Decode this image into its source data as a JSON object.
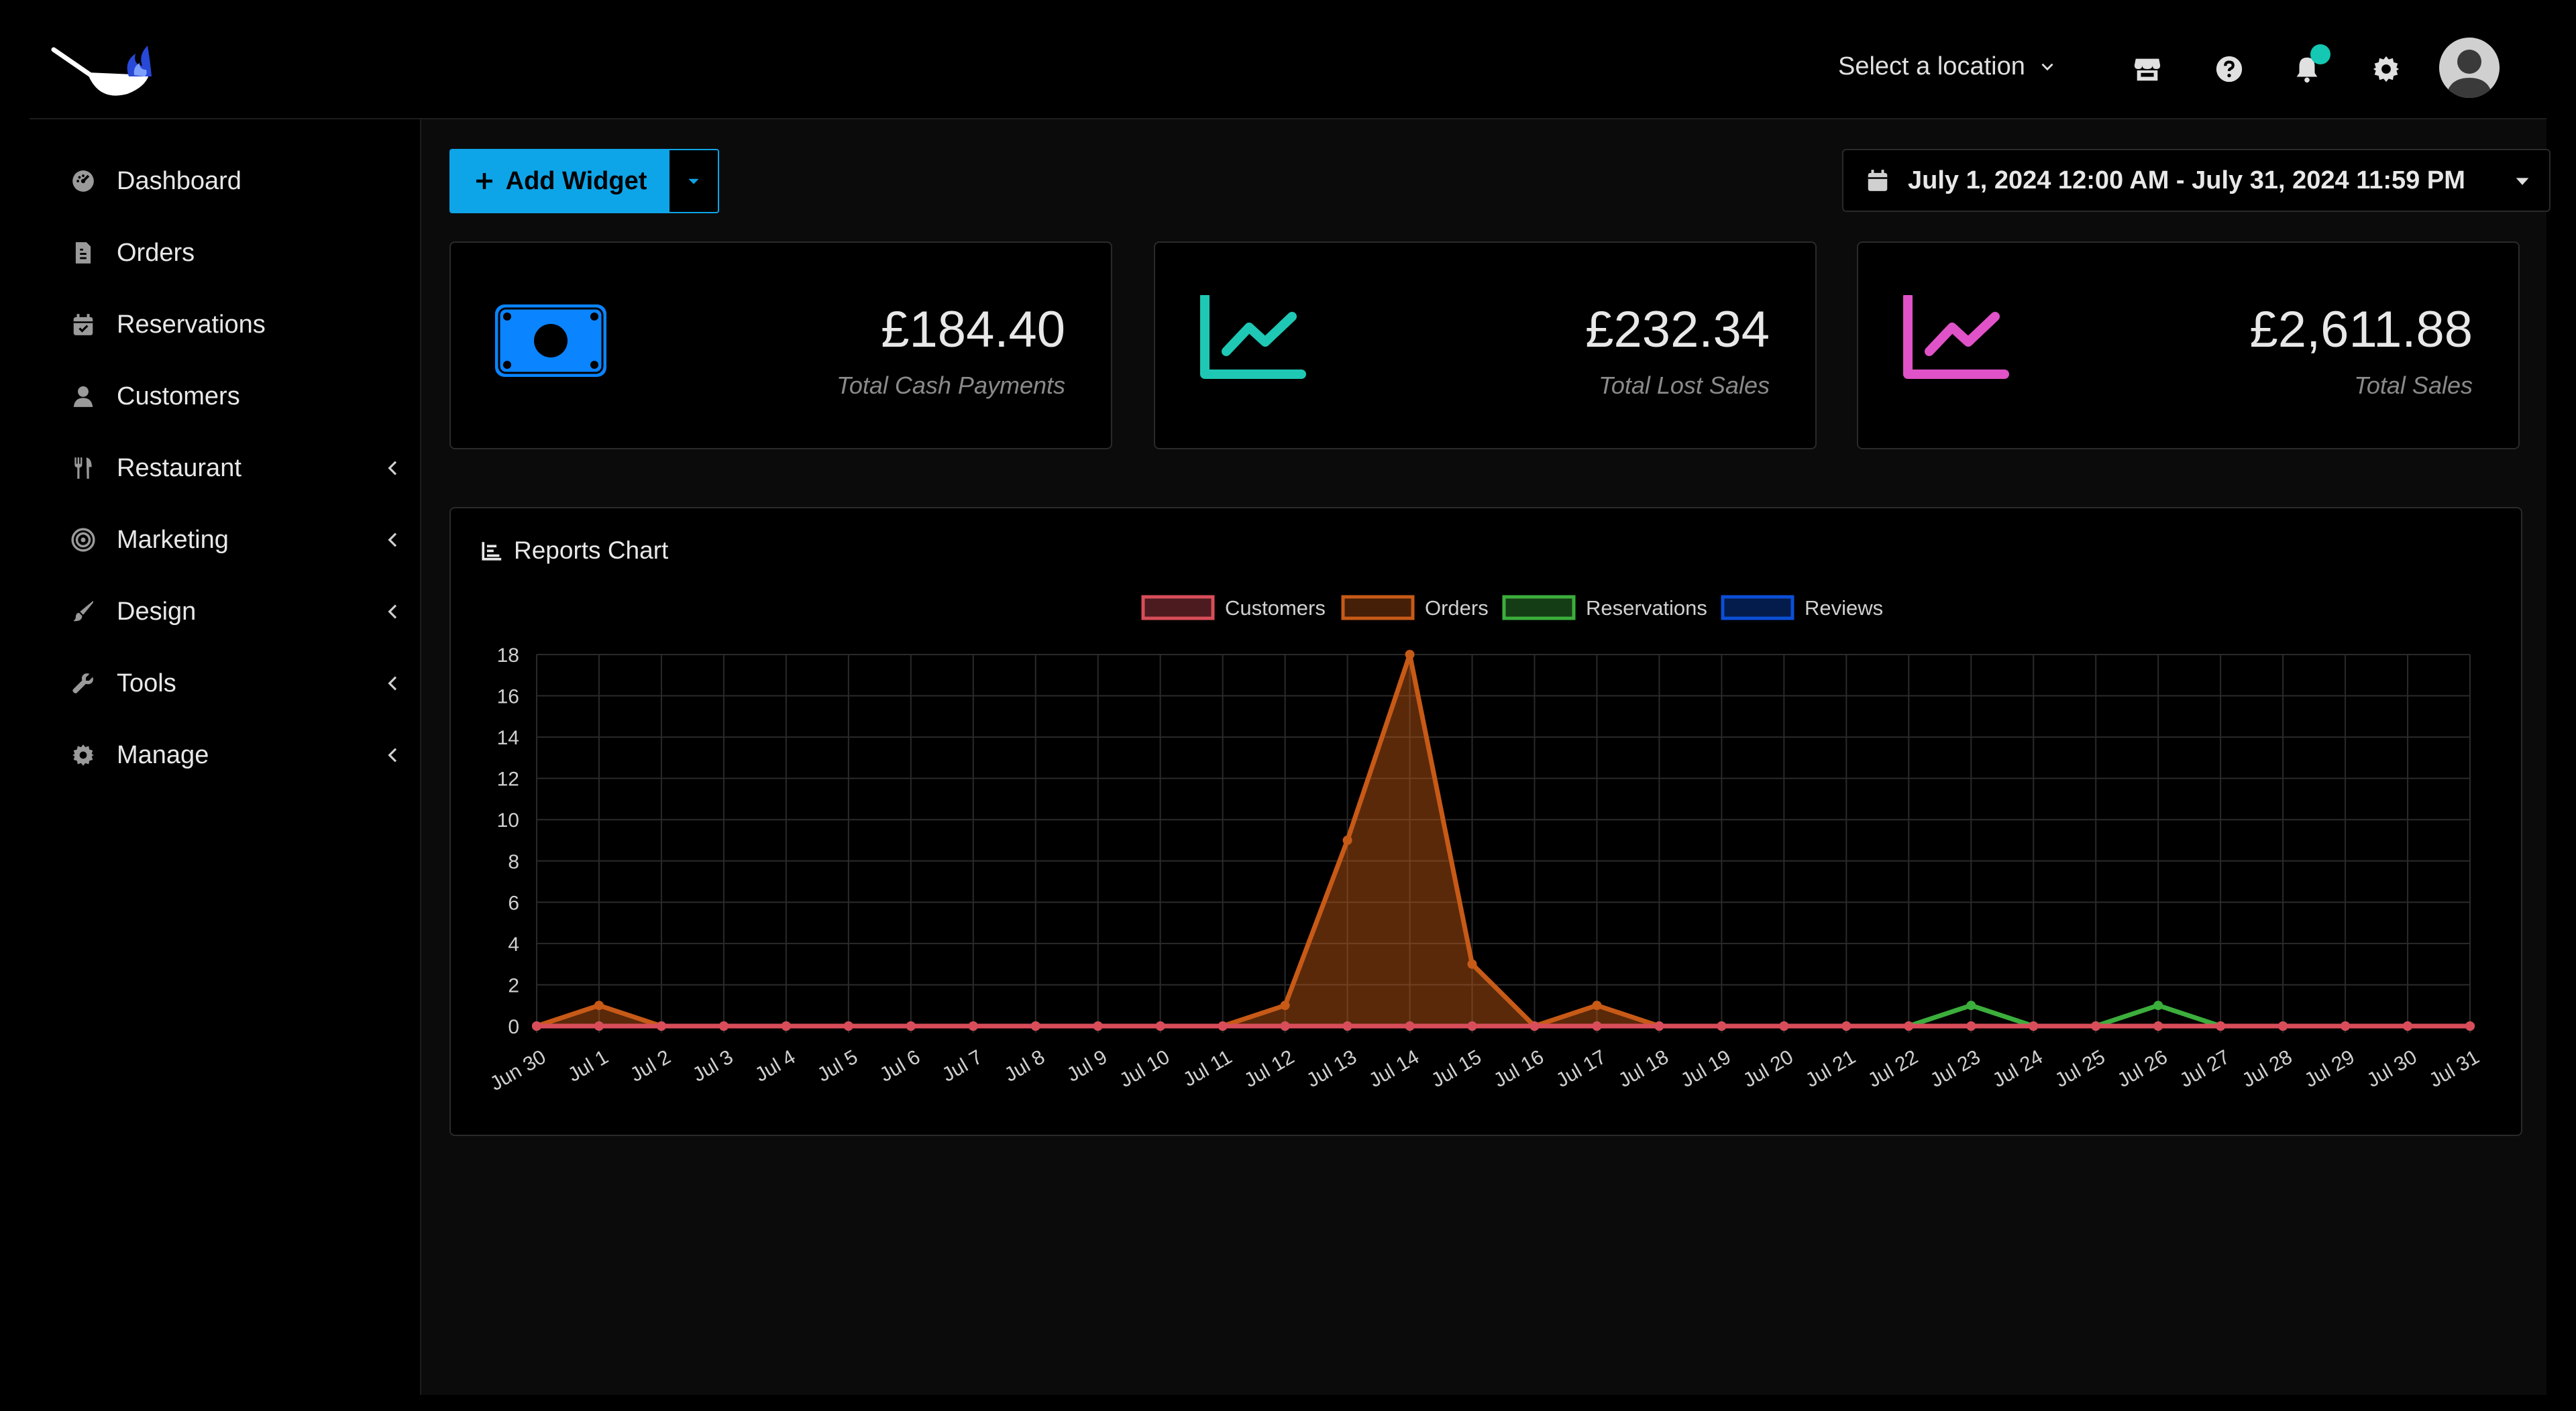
{
  "header": {
    "location_label": "Select a location",
    "icons": [
      "store-icon",
      "help-icon",
      "bell-icon",
      "gear-icon",
      "avatar"
    ]
  },
  "sidebar": {
    "items": [
      {
        "label": "Dashboard",
        "icon": "dashboard-icon",
        "has_submenu": false
      },
      {
        "label": "Orders",
        "icon": "orders-icon",
        "has_submenu": false
      },
      {
        "label": "Reservations",
        "icon": "calendar-icon",
        "has_submenu": false
      },
      {
        "label": "Customers",
        "icon": "user-icon",
        "has_submenu": false
      },
      {
        "label": "Restaurant",
        "icon": "utensils-icon",
        "has_submenu": true
      },
      {
        "label": "Marketing",
        "icon": "target-icon",
        "has_submenu": true
      },
      {
        "label": "Design",
        "icon": "brush-icon",
        "has_submenu": true
      },
      {
        "label": "Tools",
        "icon": "wrench-icon",
        "has_submenu": true
      },
      {
        "label": "Manage",
        "icon": "cog-icon",
        "has_submenu": true
      }
    ]
  },
  "toolbar": {
    "add_widget_label": "Add Widget",
    "date_range": "July 1, 2024 12:00 AM - July 31, 2024 11:59 PM"
  },
  "stats": [
    {
      "value": "£184.40",
      "label": "Total Cash Payments",
      "icon": "money-icon",
      "color": "#0a84ff"
    },
    {
      "value": "£232.34",
      "label": "Total Lost Sales",
      "icon": "line-chart-icon",
      "color": "#1ec8b4"
    },
    {
      "value": "£2,611.88",
      "label": "Total Sales",
      "icon": "line-chart-icon",
      "color": "#e052c8"
    }
  ],
  "chart_title": "Reports Chart",
  "chart_data": {
    "type": "line",
    "categories": [
      "Jun 30",
      "Jul 1",
      "Jul 2",
      "Jul 3",
      "Jul 4",
      "Jul 5",
      "Jul 6",
      "Jul 7",
      "Jul 8",
      "Jul 9",
      "Jul 10",
      "Jul 11",
      "Jul 12",
      "Jul 13",
      "Jul 14",
      "Jul 15",
      "Jul 16",
      "Jul 17",
      "Jul 18",
      "Jul 19",
      "Jul 20",
      "Jul 21",
      "Jul 22",
      "Jul 23",
      "Jul 24",
      "Jul 25",
      "Jul 26",
      "Jul 27",
      "Jul 28",
      "Jul 29",
      "Jul 30",
      "Jul 31"
    ],
    "ylim": [
      0,
      18
    ],
    "yticks": [
      0,
      2,
      4,
      6,
      8,
      10,
      12,
      14,
      16,
      18
    ],
    "grid": true,
    "legend": "top-center",
    "series": [
      {
        "name": "Customers",
        "color": "#d94d5a",
        "fill": false,
        "values": [
          0,
          0,
          0,
          0,
          0,
          0,
          0,
          0,
          0,
          0,
          0,
          0,
          0,
          0,
          0,
          0,
          0,
          0,
          0,
          0,
          0,
          0,
          0,
          0,
          0,
          0,
          0,
          0,
          0,
          0,
          0,
          0
        ]
      },
      {
        "name": "Orders",
        "color": "#c75a17",
        "fill": true,
        "values": [
          0,
          1,
          0,
          0,
          0,
          0,
          0,
          0,
          0,
          0,
          0,
          0,
          1,
          9,
          18,
          3,
          0,
          1,
          0,
          0,
          0,
          0,
          0,
          0,
          0,
          0,
          0,
          0,
          0,
          0,
          0,
          0
        ]
      },
      {
        "name": "Reservations",
        "color": "#3cae3c",
        "fill": false,
        "values": [
          0,
          0,
          0,
          0,
          0,
          0,
          0,
          0,
          0,
          0,
          0,
          0,
          0,
          0,
          0,
          0,
          0,
          0,
          0,
          0,
          0,
          0,
          0,
          1,
          0,
          0,
          1,
          0,
          0,
          0,
          0,
          0
        ]
      },
      {
        "name": "Reviews",
        "color": "#0b4fd6",
        "fill": false,
        "values": [
          0,
          0,
          0,
          0,
          0,
          0,
          0,
          0,
          0,
          0,
          0,
          0,
          0,
          0,
          0,
          0,
          0,
          0,
          0,
          0,
          0,
          0,
          0,
          0,
          0,
          0,
          0,
          0,
          0,
          0,
          0,
          0
        ]
      }
    ]
  }
}
